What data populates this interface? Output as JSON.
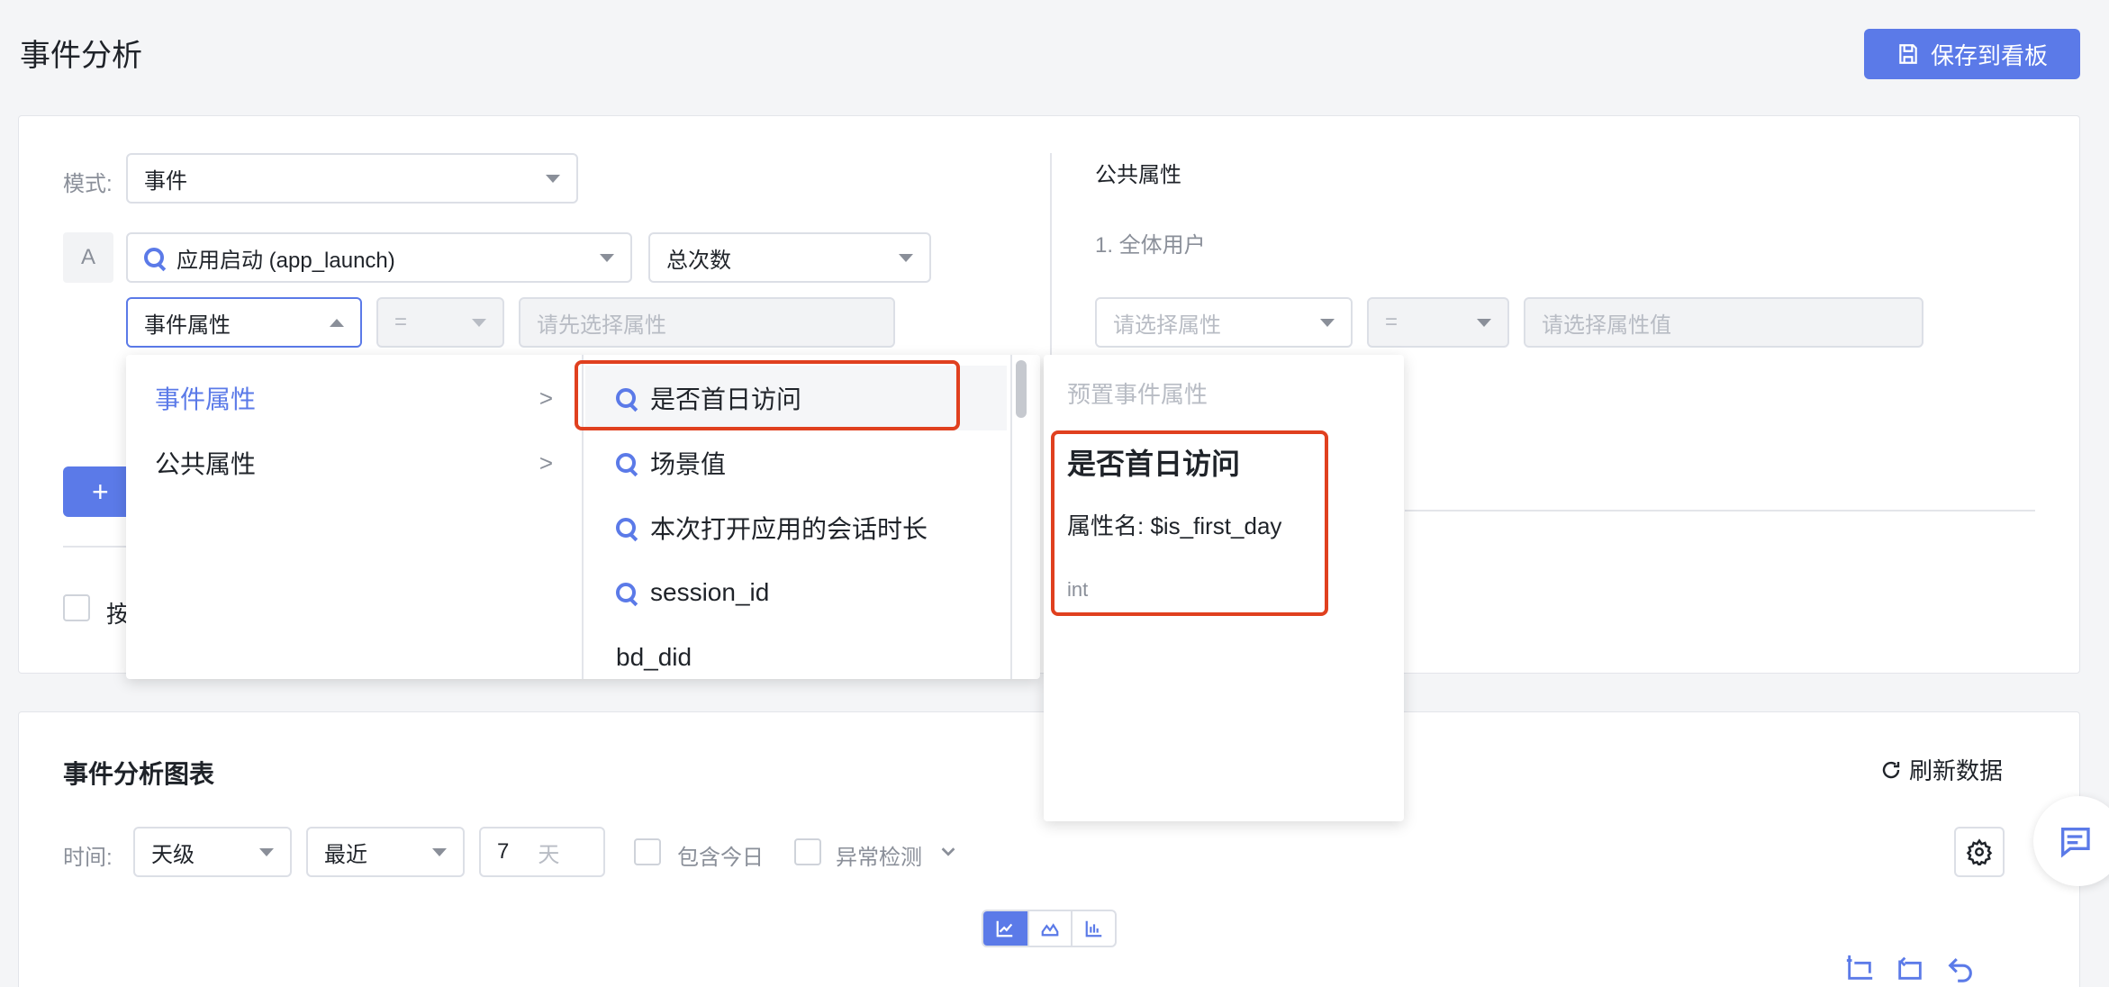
{
  "header": {
    "title": "事件分析",
    "save_label": "保存到看板"
  },
  "query": {
    "mode_label": "模式:",
    "mode_value": "事件",
    "row_label": "A",
    "event_value": "应用启动 (app_launch)",
    "metric_value": "总次数",
    "filter_type": "事件属性",
    "operator_placeholder": "=",
    "value_placeholder": "请先选择属性",
    "add_button_partial": "+",
    "group_by_partial": "按"
  },
  "common": {
    "title": "公共属性",
    "item1": "1. 全体用户",
    "attr_placeholder": "请选择属性",
    "operator_placeholder": "=",
    "value_placeholder": "请选择属性值"
  },
  "dropdown": {
    "categories": [
      {
        "label": "事件属性",
        "active": true
      },
      {
        "label": "公共属性",
        "active": false
      }
    ],
    "items": [
      {
        "label": "是否首日访问",
        "icon": "preset-icon"
      },
      {
        "label": "场景值",
        "icon": "preset-icon"
      },
      {
        "label": "本次打开应用的会话时长",
        "icon": "preset-icon"
      },
      {
        "label": "session_id",
        "icon": "preset-icon"
      },
      {
        "label": "bd_did",
        "icon": ""
      }
    ]
  },
  "detail": {
    "section": "预置事件属性",
    "name": "是否首日访问",
    "attr_line": "属性名: $is_first_day",
    "type": "int"
  },
  "chart_section": {
    "title": "事件分析图表",
    "refresh_label": "刷新数据",
    "time_label": "时间:",
    "granularity": "天级",
    "range": "最近",
    "days_value": "7",
    "days_unit": "天",
    "include_today": "包含今日",
    "anomaly": "异常检测"
  },
  "colors": {
    "accent": "#5b7ae8",
    "highlight": "#e0401f"
  }
}
